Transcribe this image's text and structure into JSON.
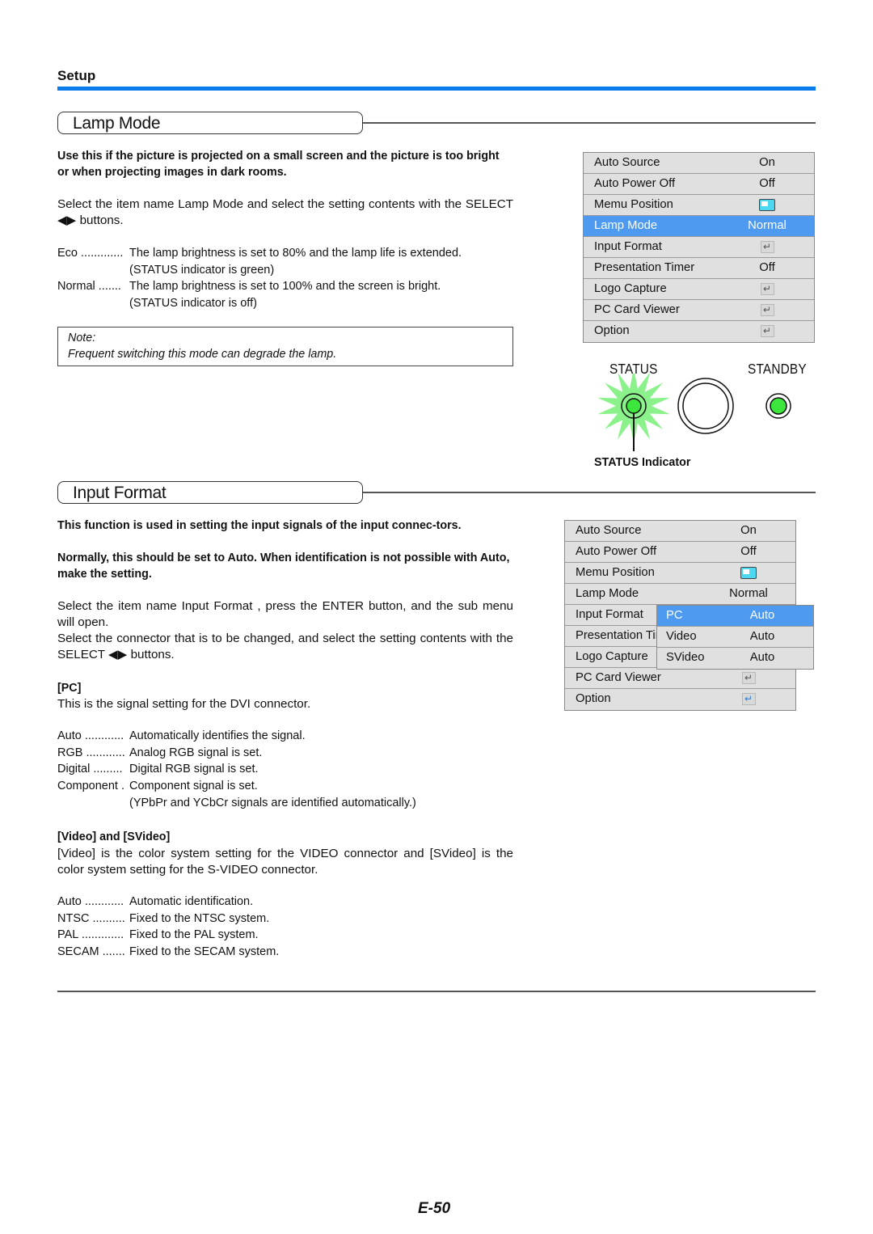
{
  "header": {
    "section": "Setup",
    "accent_color": "#0a7bea"
  },
  "lamp_mode": {
    "title": "Lamp Mode",
    "intro": "Use this if the picture is projected on a small screen and the picture is too bright or when projecting images in dark rooms.",
    "instruction": "Select the item name  Lamp Mode  and select the setting contents with the SELECT ◀▶ buttons.",
    "options": [
      {
        "term": "Eco .............",
        "desc": "The lamp brightness is set to 80% and the lamp life is extended.",
        "sub": "(STATUS indicator is green)"
      },
      {
        "term": "Normal .......",
        "desc": "The lamp brightness is set to 100% and the screen is bright.",
        "sub": "(STATUS indicator is off)"
      }
    ],
    "note": {
      "label": "Note:",
      "text": "Frequent switching this mode can degrade the lamp."
    },
    "menu": [
      {
        "label": "Auto Source",
        "value": "On",
        "type": "text"
      },
      {
        "label": "Auto Power Off",
        "value": "Off",
        "type": "text"
      },
      {
        "label": "Memu Position",
        "value": "position-icon",
        "type": "icon"
      },
      {
        "label": "Lamp Mode",
        "value": "Normal",
        "type": "text",
        "selected": true
      },
      {
        "label": "Input Format",
        "value": "enter-icon",
        "type": "enter"
      },
      {
        "label": "Presentation Timer",
        "value": "Off",
        "type": "text"
      },
      {
        "label": "Logo Capture",
        "value": "enter-icon",
        "type": "enter"
      },
      {
        "label": "PC Card Viewer",
        "value": "enter-icon",
        "type": "enter"
      },
      {
        "label": "Option",
        "value": "enter-icon",
        "type": "enter"
      }
    ],
    "panel": {
      "status_label": "STATUS",
      "standby_label": "STANDBY",
      "indicator_caption": "STATUS Indicator",
      "led_color": "#3de63d",
      "glow_color": "#7ef07e"
    }
  },
  "input_format": {
    "title": "Input Format",
    "intro1": "This function is used in setting the input signals of the input connec-tors.",
    "intro2": "Normally, this should be set to Auto. When identification is not possible with Auto, make the setting.",
    "instruction1": "Select the item name  Input Format , press the ENTER button, and the sub menu will open.",
    "instruction2": "Select the connector that is to be changed, and select the setting contents with the SELECT ◀▶ buttons.",
    "pc": {
      "heading": "[PC]",
      "desc": "This is the signal setting for the DVI connector.",
      "options": [
        {
          "term": "Auto ............",
          "desc": "Automatically identifies the signal."
        },
        {
          "term": "RGB ............",
          "desc": "Analog RGB signal is set."
        },
        {
          "term": "Digital .........",
          "desc": "Digital RGB signal is set."
        },
        {
          "term": "Component .",
          "desc": "Component signal is set."
        }
      ],
      "component_note": "(YPbPr and YCbCr signals are identified automatically.)"
    },
    "video": {
      "heading": "[Video] and [SVideo]",
      "desc": "[Video] is the color system setting for the VIDEO connector and [SVideo] is the color system setting for the S-VIDEO connector.",
      "options": [
        {
          "term": "Auto ............",
          "desc": "Automatic identification."
        },
        {
          "term": "NTSC ..........",
          "desc": "Fixed to the NTSC system."
        },
        {
          "term": "PAL .............",
          "desc": "Fixed to the PAL system."
        },
        {
          "term": "SECAM .......",
          "desc": "Fixed to the SECAM system."
        }
      ]
    },
    "menu": [
      {
        "label": "Auto Source",
        "value": "On",
        "type": "text"
      },
      {
        "label": "Auto Power Off",
        "value": "Off",
        "type": "text"
      },
      {
        "label": "Memu Position",
        "value": "position-icon",
        "type": "icon"
      },
      {
        "label": "Lamp Mode",
        "value": "Normal",
        "type": "text"
      },
      {
        "label": "Input Format",
        "value": "",
        "type": "text"
      },
      {
        "label": "Presentation Timer",
        "value": "",
        "type": "text"
      },
      {
        "label": "Logo Capture",
        "value": "",
        "type": "text"
      },
      {
        "label": "PC Card Viewer",
        "value": "enter-icon",
        "type": "enter"
      },
      {
        "label": "Option",
        "value": "enter-icon",
        "type": "enter-blue"
      }
    ],
    "submenu": [
      {
        "label": "PC",
        "value": "Auto",
        "selected": true
      },
      {
        "label": "Video",
        "value": "Auto"
      },
      {
        "label": "SVideo",
        "value": "Auto"
      }
    ]
  },
  "footer": {
    "page_number": "E-50"
  }
}
